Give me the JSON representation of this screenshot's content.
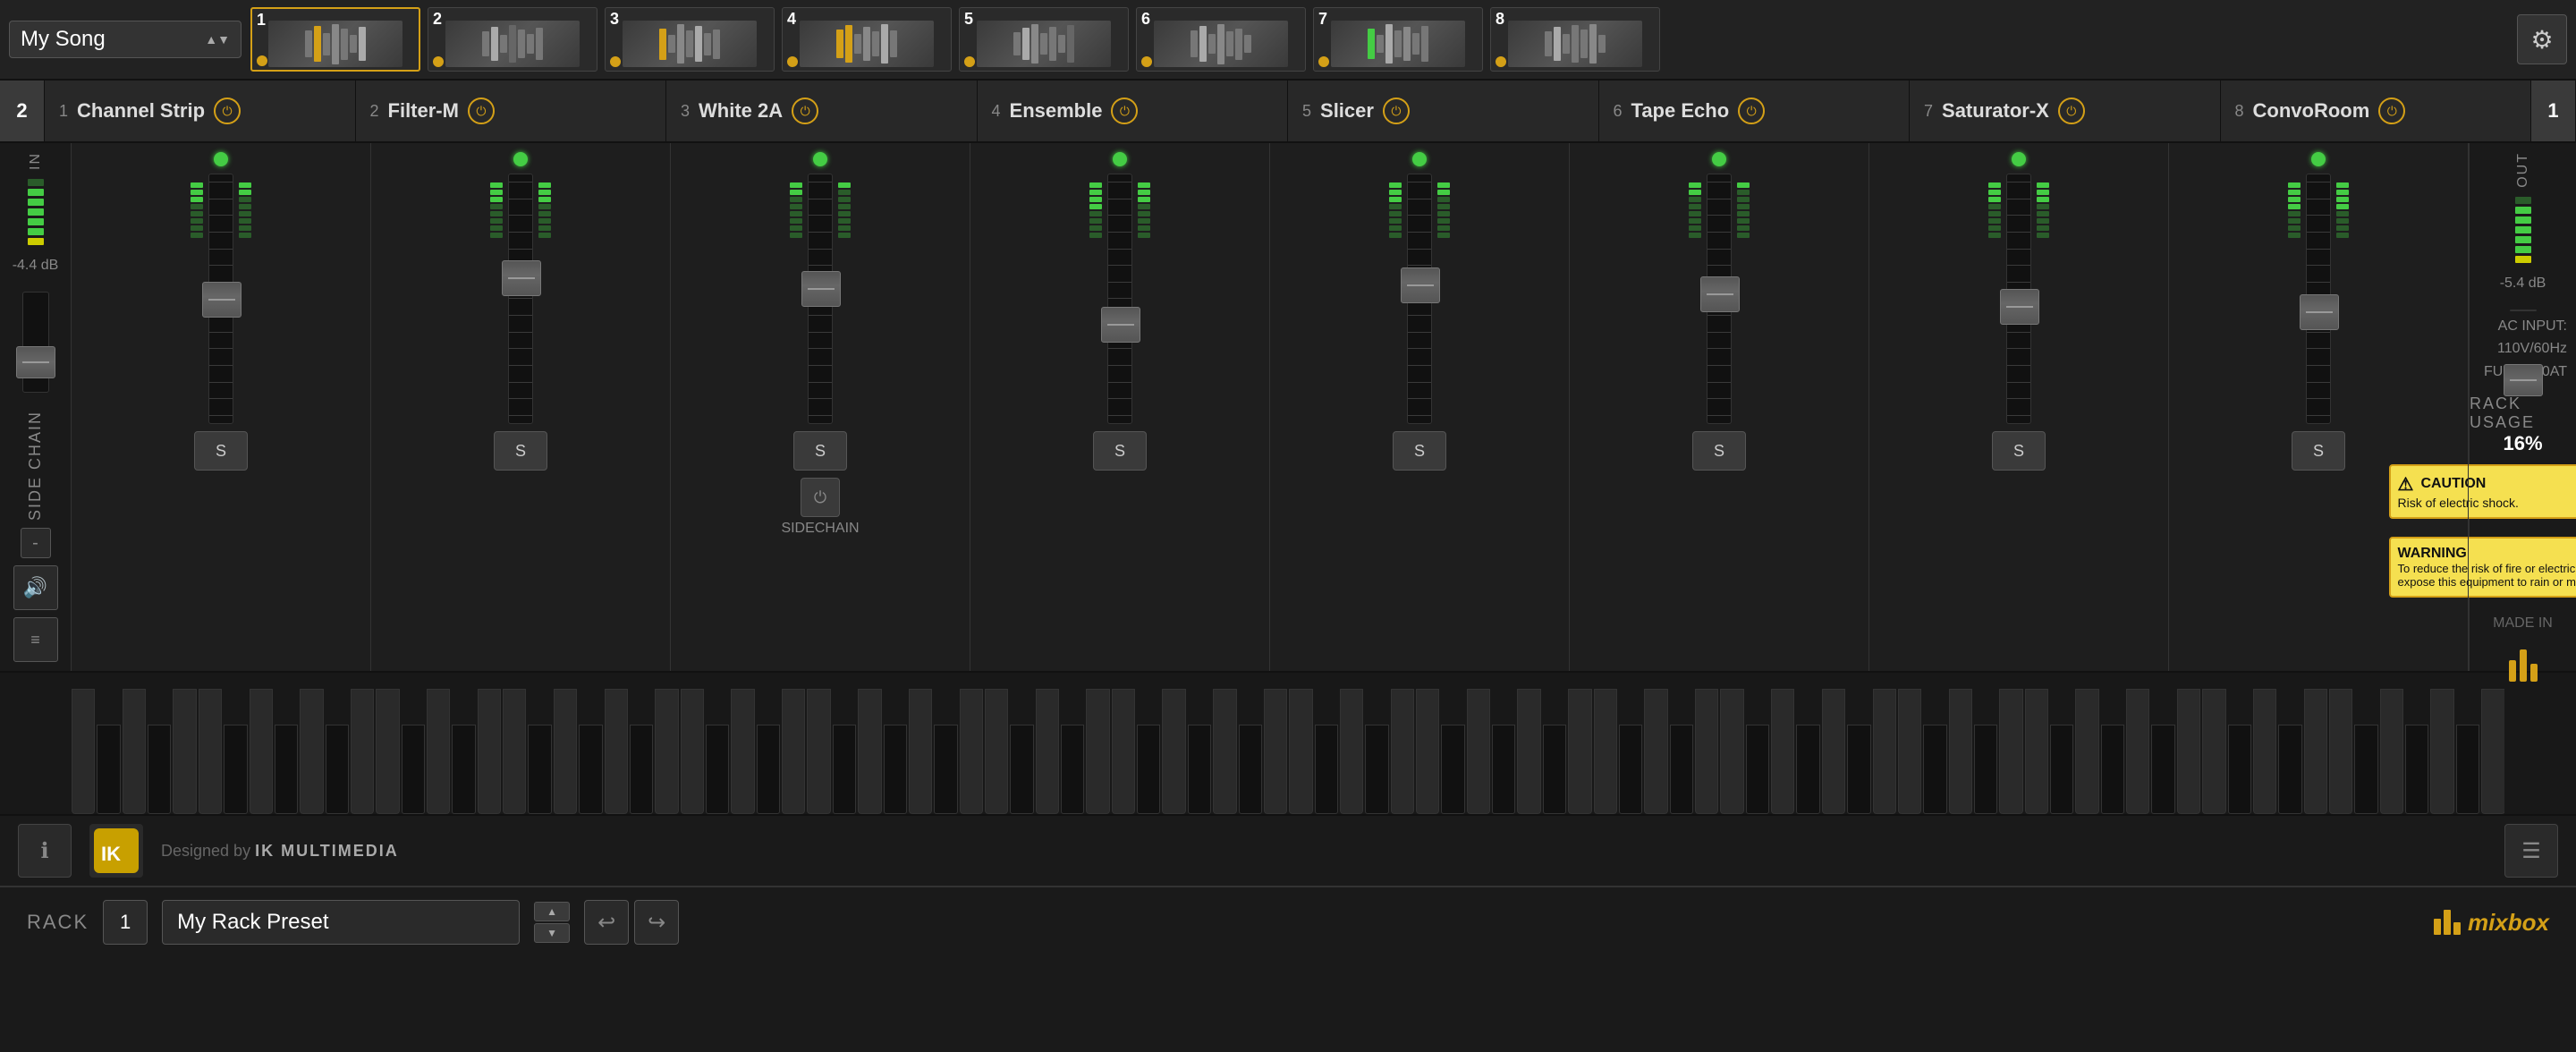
{
  "app": {
    "title": "Mixbox",
    "logo": "⚡"
  },
  "preset_bar": {
    "current_song": "My Song",
    "gear_icon": "⚙",
    "slots": [
      {
        "number": "1",
        "label": "Channel Strip",
        "active": true
      },
      {
        "number": "2",
        "label": "Filter-M",
        "active": false
      },
      {
        "number": "3",
        "label": "White 2A",
        "active": false
      },
      {
        "number": "4",
        "label": "Ensemble",
        "active": false
      },
      {
        "number": "5",
        "label": "Slicer",
        "active": false
      },
      {
        "number": "6",
        "label": "Tape Echo",
        "active": false
      },
      {
        "number": "7",
        "label": "Saturator-X",
        "active": false
      },
      {
        "number": "8",
        "label": "ConvoRoom",
        "active": false
      }
    ]
  },
  "channel_bar": {
    "left_num": "2",
    "channels": [
      {
        "num": "1",
        "name": "Channel Strip"
      },
      {
        "num": "2",
        "name": "Filter-M"
      },
      {
        "num": "3",
        "name": "White 2A"
      },
      {
        "num": "4",
        "name": "Ensemble"
      },
      {
        "num": "5",
        "name": "Slicer"
      },
      {
        "num": "6",
        "name": "Tape Echo"
      },
      {
        "num": "7",
        "name": "Saturator-X"
      },
      {
        "num": "8",
        "name": "ConvoRoom"
      }
    ],
    "right_num": "1"
  },
  "mixer": {
    "in_label": "IN",
    "out_label": "OUT",
    "in_db": "-4.4 dB",
    "out_db": "-5.4 dB",
    "side_chain_label": "SIDE CHAIN",
    "side_chain_minus": "-",
    "speaker_icon": "🔊",
    "eq_icon": "≡",
    "fader_positions": [
      0.45,
      0.35,
      0.4,
      0.55,
      0.38,
      0.42,
      0.48,
      0.5
    ],
    "channels": [
      {
        "send_label": "S",
        "sidechain": false
      },
      {
        "send_label": "S",
        "sidechain": false
      },
      {
        "send_label": "S",
        "sidechain": true
      },
      {
        "send_label": "S",
        "sidechain": false
      },
      {
        "send_label": "S",
        "sidechain": false
      },
      {
        "send_label": "S",
        "sidechain": false
      },
      {
        "send_label": "S",
        "sidechain": false
      },
      {
        "send_label": "S",
        "sidechain": false
      }
    ],
    "sidechain_label": "SIDECHAIN",
    "rack_usage_label": "RACK USAGE",
    "rack_usage_val": "16%",
    "ac_info": "AC INPUT: 110V/60Hz\nFUSE: 3.0AT",
    "caution": {
      "title": "CAUTION",
      "body": "Risk of electric shock."
    },
    "warning": {
      "title": "WARNING",
      "body": "To reduce the risk of fire or electric shock do not expose this equipment to rain or moisture"
    },
    "made_in": "MADE IN"
  },
  "status_bar": {
    "ik_logo": "IK",
    "designed_by": "Designed by",
    "ik_multimedia": "IK MULTIMEDIA",
    "icon_info": "ℹ",
    "icon_menu": "☰",
    "icon_eq": "⊞"
  },
  "bottom_bar": {
    "rack_label": "RACK",
    "rack_num": "1",
    "preset_name": "My Rack Preset",
    "undo_icon": "↩",
    "redo_icon": "↪",
    "mixbox_label": "mixbox"
  }
}
